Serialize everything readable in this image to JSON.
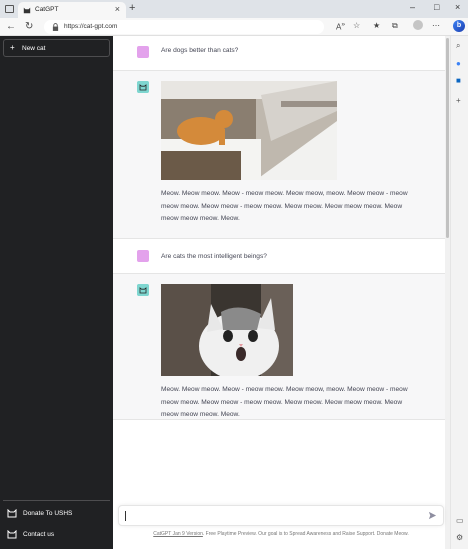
{
  "browser": {
    "tab_title": "CatGPT",
    "new_tab": "+",
    "url": "https://cat-gpt.com",
    "read_aloud": "A",
    "read_aloud_sup": "»"
  },
  "sidebar": {
    "new_chat": "New cat",
    "new_chat_plus": "+",
    "items": [
      {
        "label": "Donate To USHS",
        "icon": "cat-icon"
      },
      {
        "label": "Contact us",
        "icon": "cat-icon"
      }
    ]
  },
  "conversation": [
    {
      "role": "user",
      "text": "Are dogs better than cats?"
    },
    {
      "role": "bot",
      "image": "orange-cat-on-snowy-roof-photo",
      "text": "Meow. Meow meow. Meow - meow meow. Meow meow, meow. Meow meow - meow meow meow. Meow meow - meow meow. Meow meow. Meow meow meow. Meow meow meow meow. Meow."
    },
    {
      "role": "user",
      "text": "Are cats the most intelligent beings?"
    },
    {
      "role": "bot",
      "image": "surprised-white-cat-photo",
      "text": "Meow. Meow meow. Meow - meow meow. Meow meow, meow. Meow meow - meow meow meow. Meow meow - meow meow. Meow meow. Meow meow meow. Meow meow meow meow. Meow."
    }
  ],
  "input": {
    "value": ""
  },
  "footer": {
    "link": "CatGPT Jan 9 Version",
    "text": ". Free Playtime Preview. Our goal is to Spread Awareness and Raise Support. Donate Meow."
  },
  "colors": {
    "sidebar_bg": "#202123",
    "user_avatar": "#e3a2ec",
    "bot_avatar": "#7fd6d0",
    "bot_row_bg": "#f7f7f8"
  }
}
